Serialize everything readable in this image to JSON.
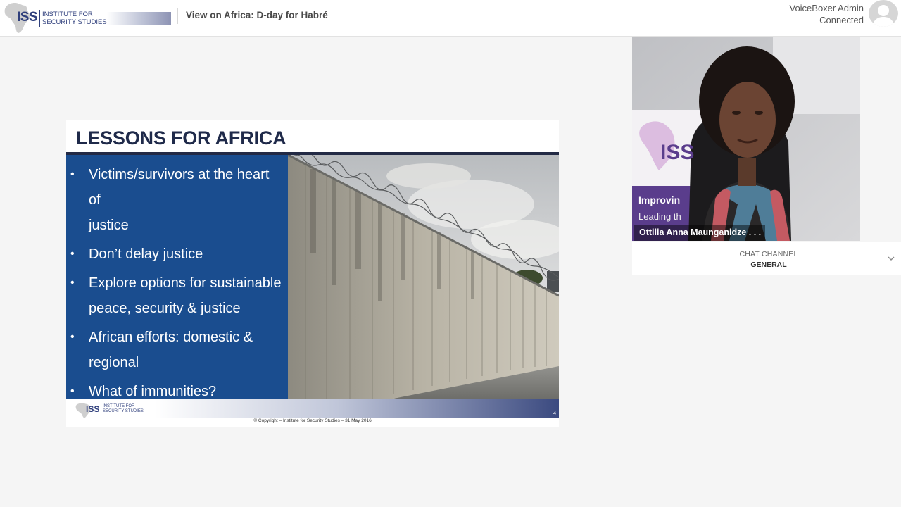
{
  "header": {
    "logo_iss": "ISS",
    "logo_line1": "INSTITUTE FOR",
    "logo_line2": "SECURITY STUDIES",
    "event_title": "View on Africa: D-day for Habré",
    "user_name": "VoiceBoxer Admin",
    "user_status": "Connected",
    "avatar_icon": "user-avatar-icon"
  },
  "slide": {
    "title": "LESSONS FOR AFRICA",
    "bullets": [
      {
        "line1": "Victims/survivors at the heart of",
        "line2": "justice"
      },
      {
        "line1": "Don’t delay justice",
        "line2": ""
      },
      {
        "line1": "Explore options for sustainable",
        "line2": "peace, security & justice"
      },
      {
        "line1": "African efforts: domestic &",
        "line2": "regional"
      },
      {
        "line1": "What of immunities?",
        "line2": ""
      }
    ],
    "footer_logo_iss": "ISS",
    "footer_logo_line1": "INSTITUTE FOR",
    "footer_logo_line2": "SECURITY STUDIES",
    "page_number": "4",
    "copyright": "© Copyright – Institute for Security Studies – 31 May 2016"
  },
  "video": {
    "speaker_name": "Ottilia Anna Maunganidze . . .",
    "background_banner_line1": "Improvin",
    "background_banner_line2": "Leading th",
    "background_logo": "ISS"
  },
  "chat": {
    "label": "CHAT CHANNEL",
    "value": "GENERAL",
    "chevron_icon": "chevron-down-icon"
  },
  "colors": {
    "brand_navy": "#2f3f7c",
    "slide_blue": "#1a4d8f",
    "title_dark": "#1f2a4a"
  }
}
